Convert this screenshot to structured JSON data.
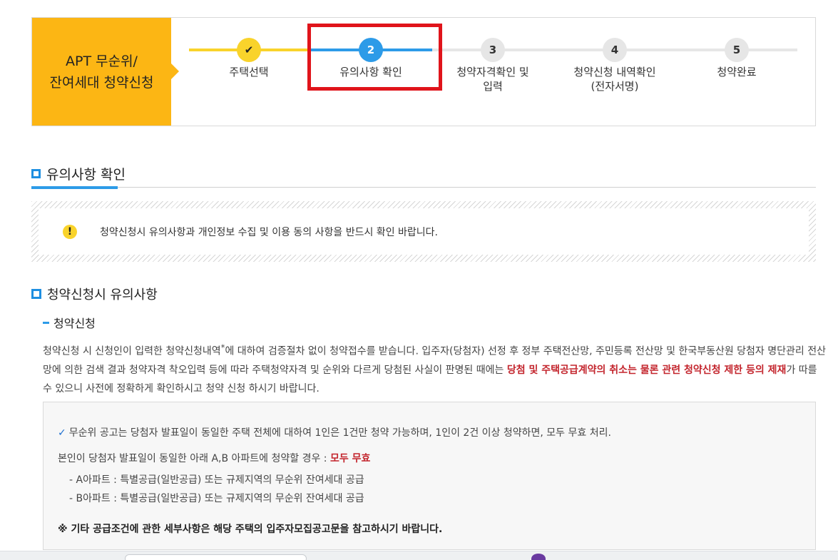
{
  "step_header": {
    "title_line1": "APT 무순위/",
    "title_line2": "잔여세대 청약신청",
    "steps": [
      {
        "number": "✔",
        "label": "주택선택",
        "label2": ""
      },
      {
        "number": "2",
        "label": "유의사항 확인",
        "label2": ""
      },
      {
        "number": "3",
        "label": "청약자격확인 및",
        "label2": "입력"
      },
      {
        "number": "4",
        "label": "청약신청 내역확인",
        "label2": "(전자서명)"
      },
      {
        "number": "5",
        "label": "청약완료",
        "label2": ""
      }
    ]
  },
  "section": {
    "title": "유의사항 확인",
    "notice_text": "청약신청시 유의사항과 개인정보 수집 및 이용 동의 사항을 반드시 확인 바랍니다.",
    "warn_symbol": "!"
  },
  "sub_section": {
    "title": "청약신청시 유의사항",
    "dash_title": "청약신청",
    "para_part1": "청약신청 시 신청인이 입력한 청약신청내역",
    "para_sup": "*",
    "para_part2": "에 대하여 검증절차 없이 청약접수를 받습니다. 입주자(당첨자) 선정 후 정부 주택전산망, 주민등록 전산망 및 한국부동산원 당첨자 명단관리 전산망에 의한 검색 결과 청약자격 착오입력 등에 따라 주택청약자격 및 순위와 다르게 당첨된 사실이 판명된 때에는 ",
    "para_red": "당첨 및 주택공급계약의 취소는 물론 관련 청약신청 제한 등의 제재",
    "para_part3": "가 따를 수 있으니 사전에 정확하게 확인하시고 청약 신청 하시기 바랍니다."
  },
  "gray_box": {
    "check_symbol": "✓",
    "line1": "무순위 공고는 당첨자 발표일이 동일한 주택 전체에 대하여 1인은 1건만 청약 가능하며, 1인이 2건 이상 청약하면, 모두 무효 처리.",
    "line2_prefix": "본인이 당첨자 발표일이 동일한 아래 A,B 아파트에 청약할 경우 : ",
    "line2_red": "모두 무효",
    "line3": "-  A아파트 : 특별공급(일반공급) 또는 규제지역의 무순위 잔여세대 공급",
    "line4": "-  B아파트 : 특별공급(일반공급) 또는 규제지역의 무순위 잔여세대 공급",
    "note": "※ 기타 공급조건에 관한 세부사항은 해당 주택의 입주자모집공고문을 참고하시기 바랍니다."
  },
  "colors": {
    "brand_yellow": "#fcb614",
    "active_blue": "#2d9be8",
    "highlight_red": "#e0141b",
    "warning_red": "#c3252d"
  }
}
